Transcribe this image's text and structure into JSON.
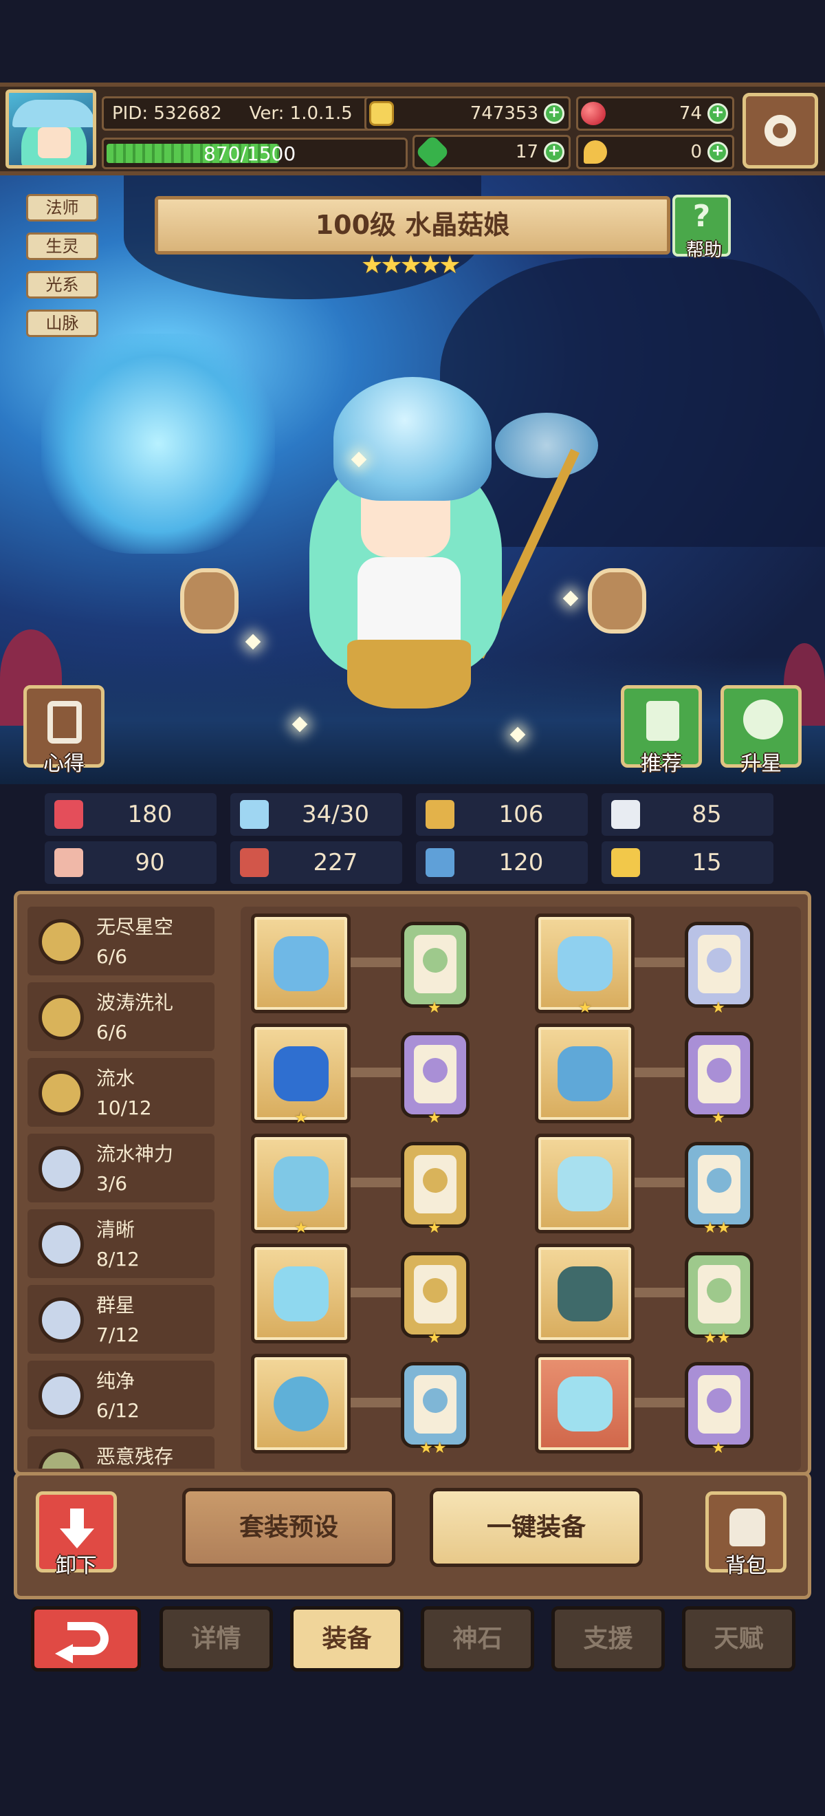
{
  "player": {
    "pid": "PID: 532682",
    "version": "Ver: 1.0.1.5",
    "xp_text": "870/1500",
    "xp_fraction": 0.58
  },
  "currencies": {
    "gold": "747353",
    "gems": "74",
    "clover": "17",
    "food": "0"
  },
  "character": {
    "title": "100级 水晶菇娘",
    "stars": "★★★★★",
    "tags": [
      "法师",
      "生灵",
      "光系",
      "山脉"
    ]
  },
  "buttons": {
    "help": "帮助",
    "insight": "心得",
    "recommend": "推荐",
    "star_up": "升星",
    "unequip": "卸下",
    "preset": "套装预设",
    "equip_all": "一键装备",
    "bag": "背包"
  },
  "stats": [
    {
      "icon": "heart-icon",
      "color": "#e44e5a",
      "value": "180"
    },
    {
      "icon": "mana-drop-icon",
      "color": "#9fd6f2",
      "value": "34/30"
    },
    {
      "icon": "shield-icon",
      "color": "#e3b24a",
      "value": "106"
    },
    {
      "icon": "wing-icon",
      "color": "#e8ecf2",
      "value": "85"
    },
    {
      "icon": "fist-icon",
      "color": "#f0b8a8",
      "value": "90"
    },
    {
      "icon": "book-icon",
      "color": "#d2564a",
      "value": "227"
    },
    {
      "icon": "boot-icon",
      "color": "#5fa0d8",
      "value": "120"
    },
    {
      "icon": "horseshoe-icon",
      "color": "#f2c84a",
      "value": "15"
    }
  ],
  "sets": [
    {
      "name": "无尽星空",
      "count": "6/6",
      "color": "#d9b35a"
    },
    {
      "name": "波涛洗礼",
      "count": "6/6",
      "color": "#d9b35a"
    },
    {
      "name": "流水",
      "count": "10/12",
      "color": "#d9b35a"
    },
    {
      "name": "流水神力",
      "count": "3/6",
      "color": "#c9d6ea"
    },
    {
      "name": "清晰",
      "count": "8/12",
      "color": "#c9d6ea"
    },
    {
      "name": "群星",
      "count": "7/12",
      "color": "#c9d6ea"
    },
    {
      "name": "纯净",
      "count": "6/12",
      "color": "#c9d6ea"
    },
    {
      "name": "恶意残存",
      "count": "",
      "color": "#a8b07a"
    }
  ],
  "equipment": [
    {
      "item": "staff-icon",
      "item_stars": "",
      "rune_color": "#9ec98c",
      "rune_stars": "★"
    },
    {
      "item": "crystal-hat-icon",
      "item_stars": "★",
      "rune_color": "#b9c2e6",
      "rune_stars": "★"
    },
    {
      "item": "blue-orb-icon",
      "item_stars": "★",
      "rune_color": "#a98fd6",
      "rune_stars": "★"
    },
    {
      "item": "crystal-armor-icon",
      "item_stars": "",
      "rune_color": "#a98fd6",
      "rune_stars": "★"
    },
    {
      "item": "heart-necklace-icon",
      "item_stars": "★",
      "rune_color": "#d9b35a",
      "rune_stars": "★"
    },
    {
      "item": "bone-icon",
      "item_stars": "",
      "rune_color": "#7fb6d6",
      "rune_stars": "★★"
    },
    {
      "item": "crystal-flower-icon",
      "item_stars": "",
      "rune_color": "#d9b35a",
      "rune_stars": "★"
    },
    {
      "item": "mask-icon",
      "item_stars": "",
      "rune_color": "#9ec98c",
      "rune_stars": "★★"
    },
    {
      "item": "ring-icon",
      "item_stars": "",
      "rune_color": "#7fb6d6",
      "rune_stars": "★★"
    },
    {
      "item": "crystal-boots-icon",
      "item_stars": "",
      "rune_color": "#a98fd6",
      "rune_stars": "★"
    }
  ],
  "tabs": [
    {
      "label": "详情",
      "active": false
    },
    {
      "label": "装备",
      "active": true
    },
    {
      "label": "神石",
      "active": false
    },
    {
      "label": "支援",
      "active": false
    },
    {
      "label": "天赋",
      "active": false
    }
  ]
}
